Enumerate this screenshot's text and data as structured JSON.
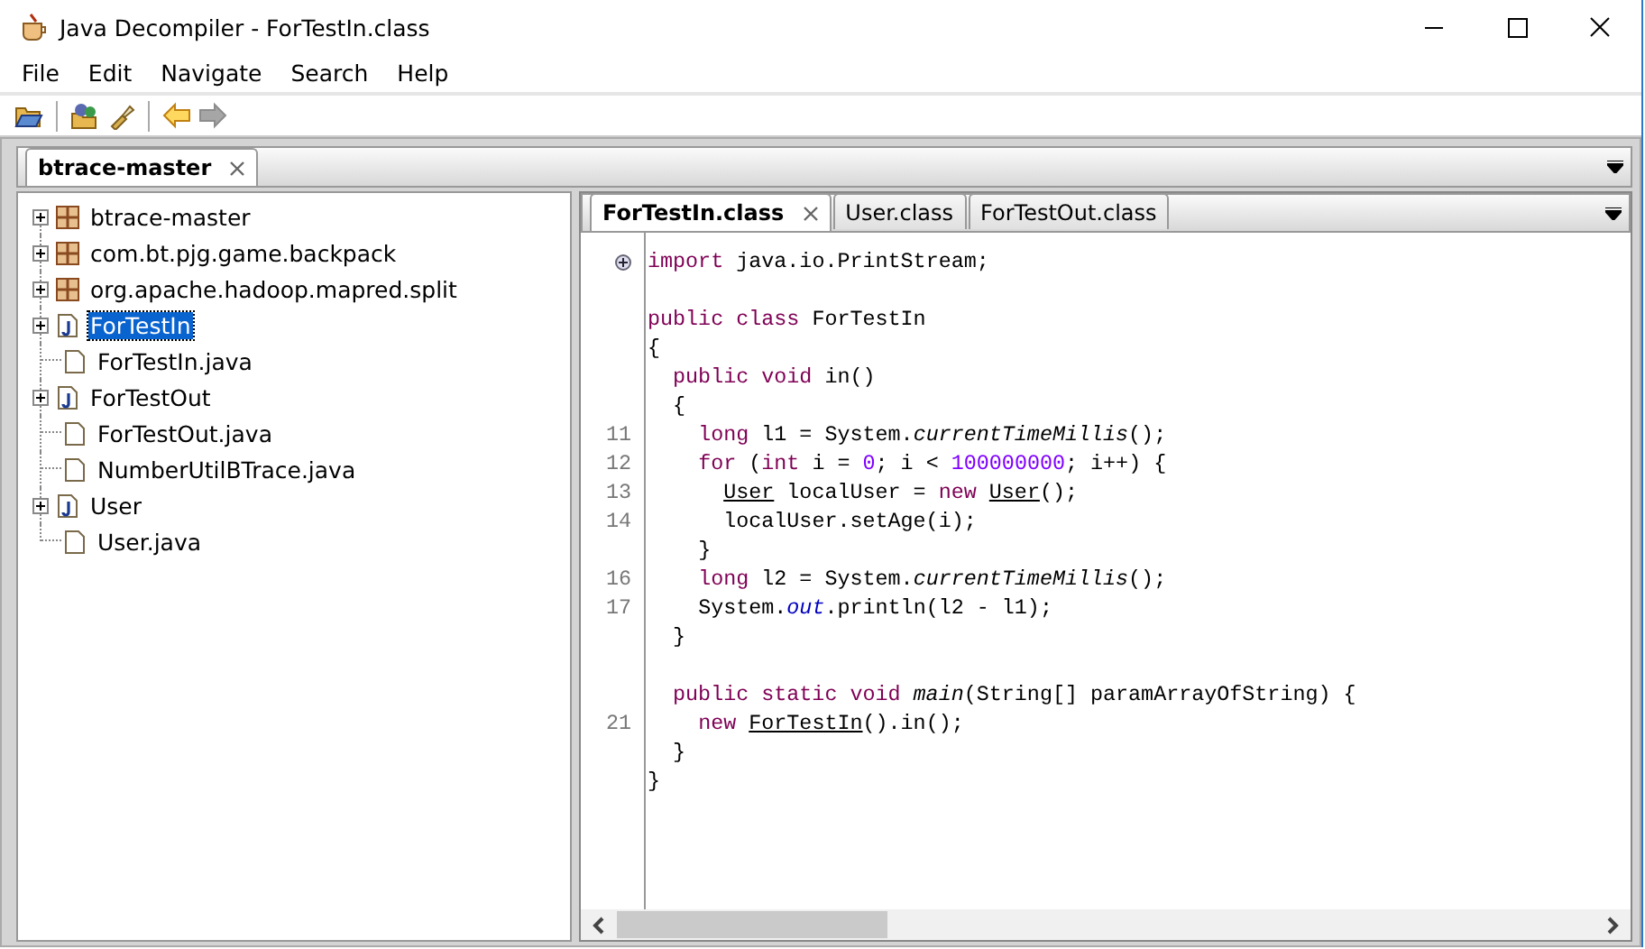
{
  "window": {
    "title": "Java Decompiler - ForTestIn.class"
  },
  "menu": [
    "File",
    "Edit",
    "Navigate",
    "Search",
    "Help"
  ],
  "toolbar": [
    {
      "kind": "open",
      "disabled": false
    },
    {
      "kind": "open-type",
      "disabled": false
    },
    {
      "kind": "search",
      "disabled": false
    },
    {
      "kind": "back",
      "disabled": false
    },
    {
      "kind": "forward",
      "disabled": true
    }
  ],
  "archive_tabs": [
    {
      "label": "btrace-master",
      "selected": true
    }
  ],
  "tree": [
    {
      "label": "btrace-master",
      "kind": "package",
      "expanded": false,
      "selected": false
    },
    {
      "label": "com.bt.pjg.game.backpack",
      "kind": "package",
      "expanded": false,
      "selected": false
    },
    {
      "label": "org.apache.hadoop.mapred.split",
      "kind": "package",
      "expanded": false,
      "selected": false
    },
    {
      "label": "ForTestIn",
      "kind": "class",
      "expanded": false,
      "selected": true
    },
    {
      "label": "ForTestIn.java",
      "kind": "file",
      "selected": false
    },
    {
      "label": "ForTestOut",
      "kind": "class",
      "expanded": false,
      "selected": false
    },
    {
      "label": "ForTestOut.java",
      "kind": "file",
      "selected": false
    },
    {
      "label": "NumberUtilBTrace.java",
      "kind": "file",
      "selected": false
    },
    {
      "label": "User",
      "kind": "class",
      "expanded": false,
      "selected": false
    },
    {
      "label": "User.java",
      "kind": "file",
      "selected": false
    }
  ],
  "editor_tabs": [
    {
      "label": "ForTestIn.class",
      "selected": true
    },
    {
      "label": "User.class",
      "selected": false
    },
    {
      "label": "ForTestOut.class",
      "selected": false
    }
  ],
  "code_blocks": [
    {
      "lines": [
        {
          "fold": true,
          "parts": [
            {
              "kind": "keyword",
              "text": "import"
            },
            {
              "kind": "plain",
              "text": " java.io.PrintStream;"
            }
          ]
        }
      ]
    },
    {
      "lines": [
        {
          "parts": [
            {
              "kind": "keyword",
              "text": "public class"
            },
            {
              "kind": "plain",
              "text": " ForTestIn"
            }
          ]
        },
        {
          "parts": [
            {
              "kind": "plain",
              "text": "{"
            }
          ]
        },
        {
          "parts": [
            {
              "kind": "keyword",
              "text": "  public void"
            },
            {
              "kind": "plain",
              "text": " in()"
            }
          ]
        },
        {
          "parts": [
            {
              "kind": "plain",
              "text": "  {"
            }
          ]
        },
        {
          "number": "11",
          "parts": [
            {
              "kind": "keyword",
              "text": "    long"
            },
            {
              "kind": "plain",
              "text": " l1 = System."
            },
            {
              "kind": "method",
              "text": "currentTimeMillis"
            },
            {
              "kind": "plain",
              "text": "();"
            }
          ]
        },
        {
          "number": "12",
          "parts": [
            {
              "kind": "keyword",
              "text": "    for"
            },
            {
              "kind": "plain",
              "text": " ("
            },
            {
              "kind": "keyword",
              "text": "int"
            },
            {
              "kind": "plain",
              "text": " i = "
            },
            {
              "kind": "number",
              "text": "0"
            },
            {
              "kind": "plain",
              "text": "; i < "
            },
            {
              "kind": "number",
              "text": "100000000"
            },
            {
              "kind": "plain",
              "text": "; i++) {"
            }
          ]
        },
        {
          "number": "13",
          "parts": [
            {
              "kind": "link",
              "text": "      User"
            },
            {
              "kind": "plain",
              "text": " localUser = "
            },
            {
              "kind": "keyword",
              "text": "new "
            },
            {
              "kind": "link",
              "text": "User"
            },
            {
              "kind": "plain",
              "text": "();"
            }
          ]
        },
        {
          "number": "14",
          "parts": [
            {
              "kind": "plain",
              "text": "      localUser.setAge(i);"
            }
          ]
        },
        {
          "parts": [
            {
              "kind": "plain",
              "text": "    }"
            }
          ]
        },
        {
          "number": "16",
          "parts": [
            {
              "kind": "keyword",
              "text": "    long"
            },
            {
              "kind": "plain",
              "text": " l2 = System."
            },
            {
              "kind": "method",
              "text": "currentTimeMillis"
            },
            {
              "kind": "plain",
              "text": "();"
            }
          ]
        },
        {
          "number": "17",
          "parts": [
            {
              "kind": "plain",
              "text": "    System."
            },
            {
              "kind": "field",
              "text": "out"
            },
            {
              "kind": "plain",
              "text": ".println(l2 - l1);"
            }
          ]
        },
        {
          "parts": [
            {
              "kind": "plain",
              "text": "  }"
            }
          ]
        }
      ]
    },
    {
      "lines": [
        {
          "parts": [
            {
              "kind": "keyword",
              "text": "  public static void "
            },
            {
              "kind": "method",
              "text": "main"
            },
            {
              "kind": "plain",
              "text": "(String[] paramArrayOfString) {"
            }
          ]
        },
        {
          "number": "21",
          "parts": [
            {
              "kind": "keyword",
              "text": "    new "
            },
            {
              "kind": "link",
              "text": "ForTestIn"
            },
            {
              "kind": "plain",
              "text": "().in();"
            }
          ]
        },
        {
          "parts": [
            {
              "kind": "plain",
              "text": "  }"
            }
          ]
        },
        {
          "parts": [
            {
              "kind": "plain",
              "text": "}"
            }
          ]
        }
      ]
    }
  ]
}
